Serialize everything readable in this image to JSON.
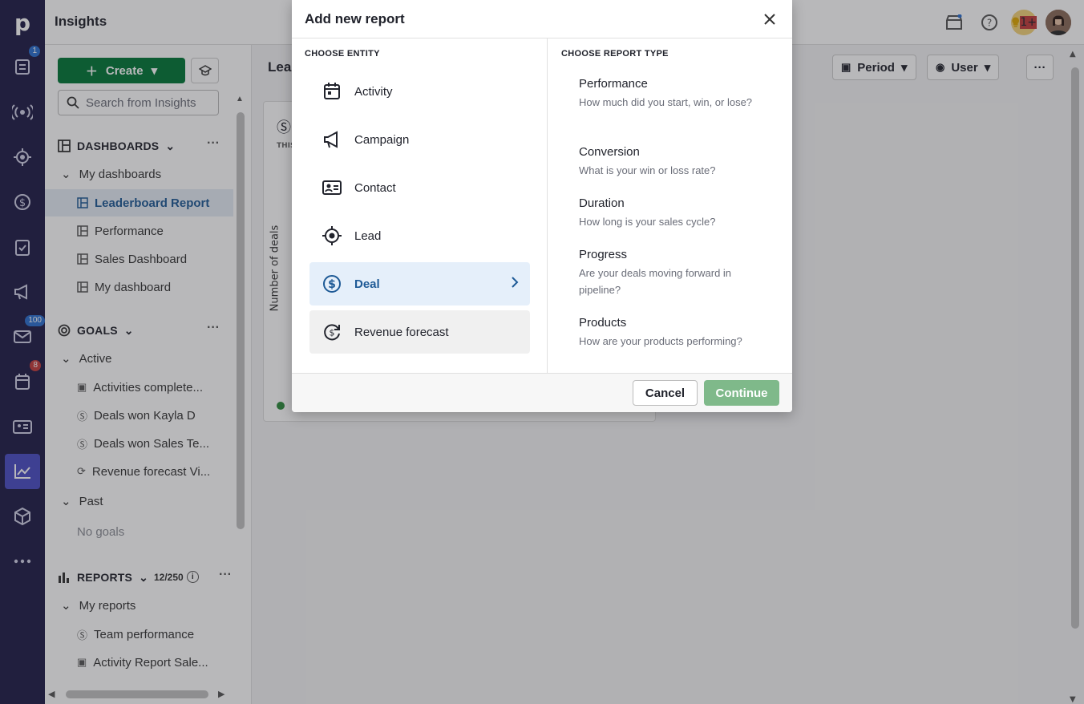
{
  "topbar": {
    "title": "Insights",
    "notification_badge": "1+"
  },
  "rail": {
    "badges": {
      "leads": "1",
      "mail": "100",
      "activities": "8"
    }
  },
  "sidebar": {
    "create_label": "Create",
    "search_placeholder": "Search from Insights",
    "dashboards": {
      "title": "DASHBOARDS",
      "group": "My dashboards",
      "items": [
        "Leaderboard Report",
        "Performance",
        "Sales Dashboard",
        "My dashboard"
      ]
    },
    "goals": {
      "title": "GOALS",
      "active_group": "Active",
      "active_items": [
        "Activities complete...",
        "Deals won Kayla D",
        "Deals won Sales Te...",
        "Revenue forecast Vi..."
      ],
      "past_group": "Past",
      "empty": "No goals"
    },
    "reports": {
      "title": "REPORTS",
      "count": "12/250",
      "group": "My reports",
      "items": [
        "Team performance",
        "Activity Report Sale..."
      ]
    }
  },
  "main": {
    "report_title_partial": "Lea",
    "period_label": "Period",
    "user_label": "User",
    "card_tag": "THIS",
    "y_axis": "Number of deals"
  },
  "modal": {
    "title": "Add new report",
    "entity_label": "CHOOSE ENTITY",
    "report_type_label": "CHOOSE REPORT TYPE",
    "entities": [
      "Activity",
      "Campaign",
      "Contact",
      "Lead",
      "Deal",
      "Revenue forecast"
    ],
    "selected_entity": "Deal",
    "report_types": [
      {
        "name": "Performance",
        "desc": "How much did you start, win, or lose?"
      },
      {
        "name": "Conversion",
        "desc": "What is your win or loss rate?"
      },
      {
        "name": "Duration",
        "desc": "How long is your sales cycle?"
      },
      {
        "name": "Progress",
        "desc": "Are your deals moving forward in pipeline?"
      },
      {
        "name": "Products",
        "desc": "How are your products performing?"
      }
    ],
    "cancel_label": "Cancel",
    "continue_label": "Continue"
  },
  "colors": {
    "rail": "#1f1c46",
    "create": "#017737",
    "selected_text": "#1e5a96",
    "continue_disabled": "#7fb98a"
  }
}
